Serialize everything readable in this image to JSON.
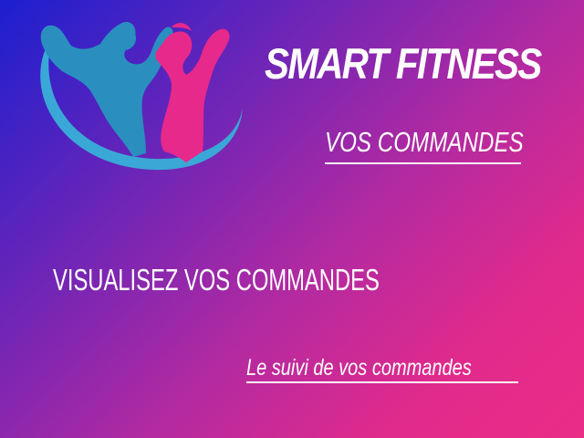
{
  "header": {
    "brand": "SMART FITNESS",
    "page_title": "VOS COMMANDES"
  },
  "main": {
    "heading": "VISUALISEZ VOS COMMANDES",
    "link": "Le suivi de vos commandes"
  },
  "logo": {
    "icon": "fitness-couple-logo-icon",
    "colors": {
      "man": "#2a8fbf",
      "woman": "#e6298a",
      "ring": "#3aa8d6"
    }
  }
}
